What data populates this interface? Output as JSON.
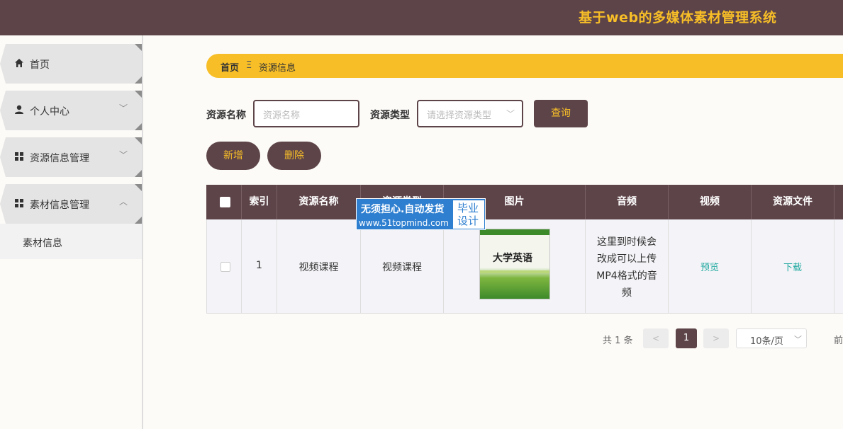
{
  "header": {
    "title": "基于web的多媒体素材管理系统"
  },
  "sidebar": {
    "items": [
      {
        "label": "首页",
        "icon": "home-icon",
        "chevron": ""
      },
      {
        "label": "个人中心",
        "icon": "user-icon",
        "chevron": "﹀"
      },
      {
        "label": "资源信息管理",
        "icon": "grid-icon",
        "chevron": "﹀"
      },
      {
        "label": "素材信息管理",
        "icon": "grid-icon",
        "chevron": "︿"
      }
    ],
    "submenu": [
      {
        "label": "素材信息"
      }
    ]
  },
  "breadcrumb": {
    "home": "首页",
    "separator": "Ξ",
    "current": "资源信息"
  },
  "search": {
    "name_label": "资源名称",
    "name_placeholder": "资源名称",
    "type_label": "资源类型",
    "type_placeholder": "请选择资源类型",
    "query_button": "查询"
  },
  "actions": {
    "add": "新增",
    "delete": "删除"
  },
  "table": {
    "headers": [
      "",
      "索引",
      "资源名称",
      "资源类型",
      "图片",
      "音频",
      "视频",
      "资源文件"
    ],
    "rows": [
      {
        "index": "1",
        "name": "视频课程",
        "type": "视频课程",
        "image_text": "大学英语",
        "audio": "这里到时候会改成可以上传MP4格式的音频",
        "video": "预览",
        "file": "下载"
      }
    ]
  },
  "watermark": {
    "line1": "无须担心.自动发货",
    "line2": "www.51topmind.com",
    "badge": "毕业设计"
  },
  "pagination": {
    "total": "共 1 条",
    "prev": "<",
    "current": "1",
    "next": ">",
    "page_size": "10条/页",
    "goto": "前往"
  },
  "colors": {
    "primary": "#5d4449",
    "accent": "#f7be27",
    "link": "#22a9a0"
  }
}
